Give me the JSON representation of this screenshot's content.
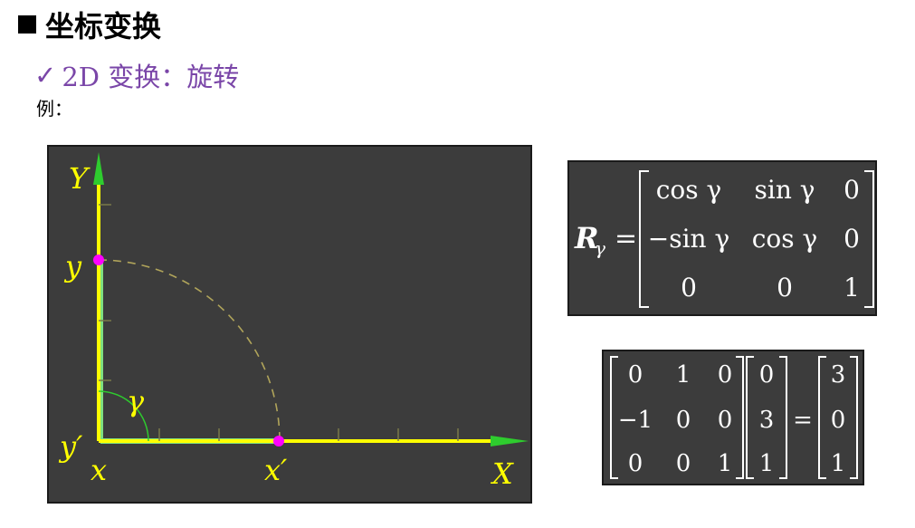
{
  "header": {
    "title": "坐标变换",
    "subtitle_check": "✓",
    "subtitle": "2D 变换：旋转",
    "example_label": "例："
  },
  "diagram": {
    "axis_y_label": "Y",
    "axis_x_label": "X",
    "point_y_label": "y",
    "point_y_prime_label": "y′",
    "origin_x_label": "x",
    "point_x_prime_label": "x′",
    "angle_label": "γ",
    "colors": {
      "axis": "#ffff00",
      "arrow": "#2ecc2e",
      "point": "#ff00ff",
      "arc": "#b0a45a",
      "background": "#3c3c3c"
    }
  },
  "rotation_matrix": {
    "lhs_symbol": "R",
    "lhs_subscript": "γ",
    "equals": "=",
    "rows": [
      [
        "cos γ",
        "sin γ",
        "0"
      ],
      [
        "−sin γ",
        "cos γ",
        "0"
      ],
      [
        "0",
        "0",
        "1"
      ]
    ]
  },
  "example_equation": {
    "matrix": [
      [
        "0",
        "1",
        "0"
      ],
      [
        "−1",
        "0",
        "0"
      ],
      [
        "0",
        "0",
        "1"
      ]
    ],
    "vector": [
      "0",
      "3",
      "1"
    ],
    "equals": "=",
    "result": [
      "3",
      "0",
      "1"
    ]
  }
}
